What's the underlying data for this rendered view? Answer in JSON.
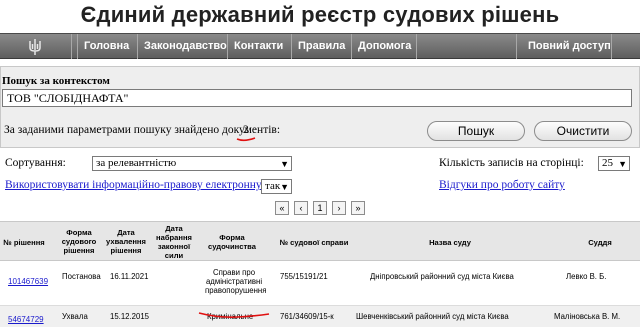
{
  "site_title": "Єдиний державний реєстр судових рішень",
  "nav": {
    "logo_icon": "trident-icon",
    "items": [
      "Головна",
      "Законодавство",
      "Контакти",
      "Правила",
      "Допомога"
    ],
    "full_access": "Повний доступ"
  },
  "search": {
    "label": "Пошук за контекстом",
    "value": "ТОВ \"СЛОБІДНАФТА\"",
    "found_text": "За заданими параметрами пошуку знайдено документів:",
    "found_count": "2",
    "search_button": "Пошук",
    "clear_button": "Очистити"
  },
  "options": {
    "sort_label": "Сортування:",
    "sort_value": "за релевантністю",
    "per_page_label": "Кількість записів на сторінці:",
    "per_page_value": "25",
    "use_base_link": "Використовувати інформаційно-правову електронну базу:",
    "use_base_value": "так",
    "feedback_link": "Відгуки про роботу сайту"
  },
  "pager": {
    "first": "«",
    "prev": "‹",
    "current": "1",
    "next": "›",
    "last": "»"
  },
  "table": {
    "headers": {
      "number": "№ рішення",
      "form": "Форма судового рішення",
      "adoption_date": "Дата ухвалення рішення",
      "effective_date": "Дата набрання законної сили",
      "proceeding_form": "Форма судочинства",
      "case_number": "№ судової справи",
      "court": "Назва суду",
      "judge": "Суддя"
    },
    "rows": [
      {
        "number": "101467639",
        "form": "Постанова",
        "adoption_date": "16.11.2021",
        "effective_date": "",
        "proceeding_form": "Справи про адміністративні правопорушення",
        "case_number": "755/15191/21",
        "court": "Дніпровський районний суд міста Києва",
        "judge": "Левко В. Б."
      },
      {
        "number": "54674729",
        "form": "Ухвала",
        "adoption_date": "15.12.2015",
        "effective_date": "",
        "proceeding_form": "Кримінальне",
        "case_number": "761/34609/15-к",
        "court": "Шевченківський районний суд міста Києва",
        "judge": "Маліновська В. М."
      }
    ]
  },
  "colors": {
    "nav_bg": "#6e6e6e",
    "panel_bg": "#eeeeee",
    "link": "#1a1acc",
    "annotation_red": "#e01010"
  }
}
